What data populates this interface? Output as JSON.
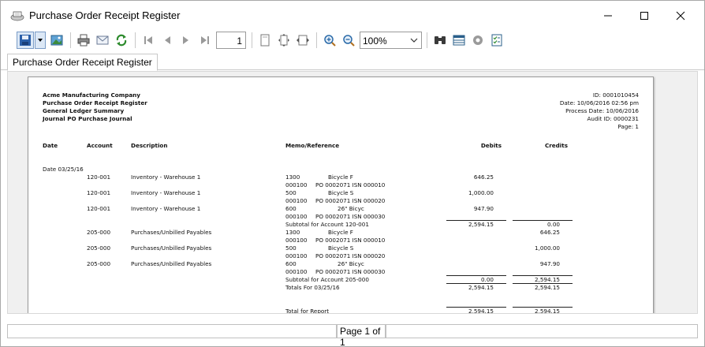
{
  "window": {
    "title": "Purchase Order Receipt Register"
  },
  "toolbar": {
    "page_number": "1",
    "zoom_value": "100%",
    "icons": [
      "save-icon",
      "dropdown-arrow-icon",
      "export-image-icon",
      "print-icon",
      "email-icon",
      "refresh-icon",
      "first-page-icon",
      "previous-page-icon",
      "next-page-icon",
      "last-page-icon",
      "page-setup-icon",
      "fit-page-icon",
      "page-width-icon",
      "zoom-in-icon",
      "zoom-out-icon",
      "binoculars-icon",
      "layout-icon",
      "settings-icon",
      "checklist-icon"
    ]
  },
  "tab": {
    "label": "Purchase Order Receipt Register"
  },
  "report": {
    "header_left": [
      "Acme Manufacturing Company",
      "Purchase Order Receipt Register",
      "General Ledger Summary",
      "Journal PO Purchase Journal"
    ],
    "header_right": [
      "ID: 0001010454",
      "Date: 10/06/2016 02:56 pm",
      "Process Date: 10/06/2016",
      "Audit ID: 0000231",
      "Page: 1"
    ],
    "columns": {
      "date": "Date",
      "account": "Account",
      "description": "Description",
      "memo": "Memo/Reference",
      "debits": "Debits",
      "credits": "Credits"
    },
    "date_label": "Date 03/25/16",
    "entries": [
      {
        "account": "120-001",
        "description": "Inventory - Warehouse 1",
        "memo1a": "1300",
        "memo1b": "Bicycle F",
        "memo2a": "000100",
        "memo2b": "PO 0002071 ISN 000010",
        "debit": "646.25",
        "credit": ""
      },
      {
        "account": "120-001",
        "description": "Inventory - Warehouse 1",
        "memo1a": "500",
        "memo1b": "Bicycle S",
        "memo2a": "000100",
        "memo2b": "PO 0002071 ISN 000020",
        "debit": "1,000.00",
        "credit": ""
      },
      {
        "account": "120-001",
        "description": "Inventory - Warehouse 1",
        "memo1a": "600",
        "memo1b": "26\" Bicyc",
        "memo2a": "000100",
        "memo2b": "PO 0002071 ISN 000030",
        "debit": "947.90",
        "credit": ""
      },
      {
        "account": "205-000",
        "description": "Purchases/Unbilled Payables",
        "memo1a": "1300",
        "memo1b": "Bicycle F",
        "memo2a": "000100",
        "memo2b": "PO 0002071 ISN 000010",
        "debit": "",
        "credit": "646.25"
      },
      {
        "account": "205-000",
        "description": "Purchases/Unbilled Payables",
        "memo1a": "500",
        "memo1b": "Bicycle S",
        "memo2a": "000100",
        "memo2b": "PO 0002071 ISN 000020",
        "debit": "",
        "credit": "1,000.00"
      },
      {
        "account": "205-000",
        "description": "Purchases/Unbilled Payables",
        "memo1a": "600",
        "memo1b": "26\" Bicyc",
        "memo2a": "000100",
        "memo2b": "PO 0002071 ISN 000030",
        "debit": "",
        "credit": "947.90"
      }
    ],
    "subtotal_120": {
      "label": "Subtotal for Account 120-001",
      "debit": "2,594.15",
      "credit": "0.00"
    },
    "subtotal_205": {
      "label": "Subtotal for Account 205-000",
      "debit": "0.00",
      "credit": "2,594.15"
    },
    "totals_date": {
      "label": "Totals For 03/25/16",
      "debit": "2,594.15",
      "credit": "2,594.15"
    },
    "total_report": {
      "label": "Total for Report",
      "debit": "2,594.15",
      "credit": "2,594.15"
    }
  },
  "status": {
    "page_text": "Page 1 of 1"
  }
}
